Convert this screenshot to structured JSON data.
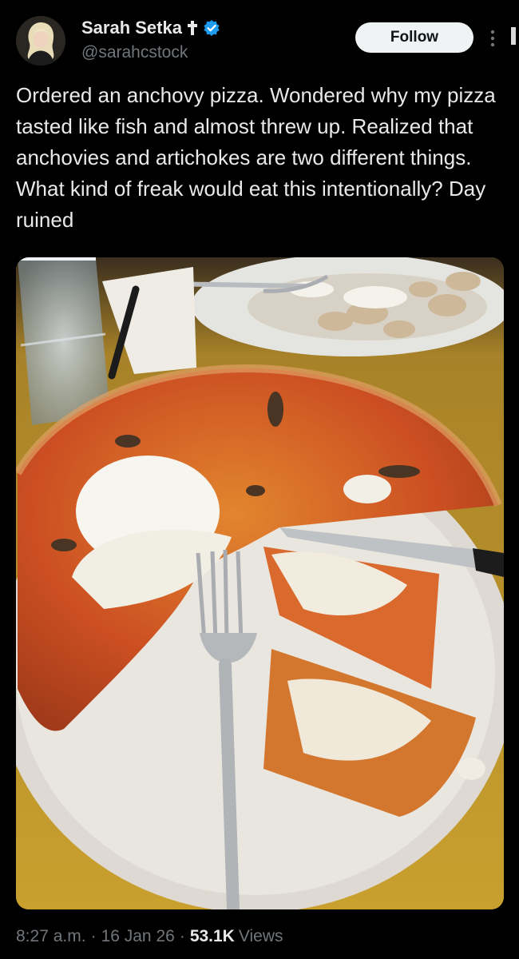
{
  "author": {
    "display_name": "Sarah Setka",
    "handle": "@sarahcstock",
    "avatar_icon": "profile-photo",
    "badges": [
      "cross-icon",
      "verified-icon"
    ],
    "verified_color": "#1d9bf0"
  },
  "actions": {
    "follow_label": "Follow",
    "more_icon": "more-vertical-icon"
  },
  "tweet": {
    "text": "Ordered an anchovy pizza. Wondered why my pizza tasted like fish and almost threw up. Realized that anchovies and artichokes are two different things. What kind of freak would eat this intentionally? Day ruined"
  },
  "meta": {
    "time": "8:27 a.m.",
    "date": "16 Jan 26",
    "views_count": "53.1K",
    "views_label": "Views"
  },
  "colors": {
    "background": "#000000",
    "text_primary": "#e7e9ea",
    "text_secondary": "#71767b",
    "follow_bg": "#eff3f4"
  }
}
